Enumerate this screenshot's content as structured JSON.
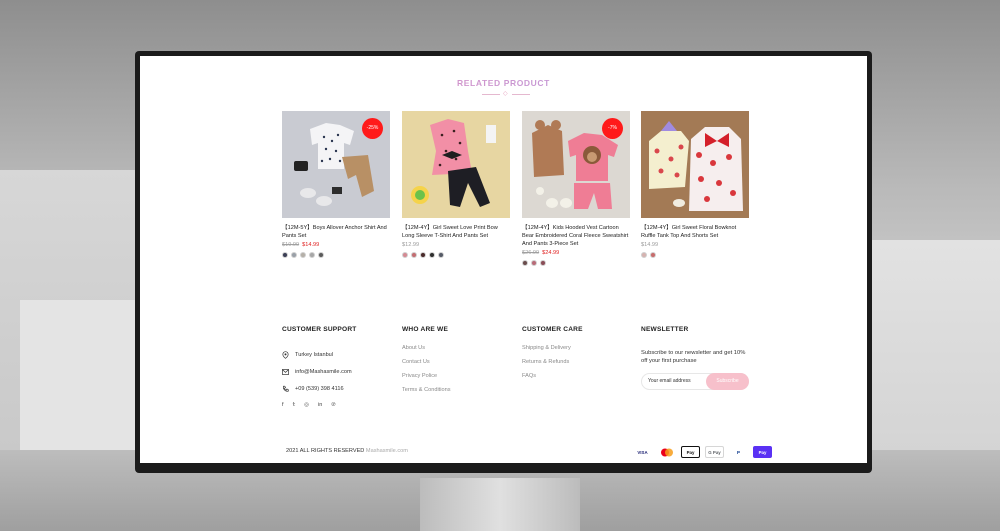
{
  "section": {
    "title": "RELATED PRODUCT"
  },
  "products": [
    {
      "name": "【12M-5Y】Boys Allover Anchor Shirt And Pants Set",
      "old_price": "$19.99",
      "price": "$14.99",
      "badge": "-25%",
      "swatches": [
        "#3b3f55",
        "#9aa0a8",
        "#b5b0a8",
        "#a7a7a7",
        "#5b5b5b"
      ]
    },
    {
      "name": "【12M-4Y】Girl Sweet Love Print Bow Long Sleeve T-Shirt And Pants Set",
      "price": "$12.99",
      "swatches": [
        "#d58a93",
        "#c46d72",
        "#4a2a2a",
        "#2d2d2d",
        "#555a66"
      ]
    },
    {
      "name": "【12M-4Y】Kids Hooded Vest Cartoon Bear Embroidered Coral Fleece Sweatshirt And Pants 3-Piece Set",
      "old_price": "$26.99",
      "price": "$24.99",
      "badge": "-7%",
      "swatches": [
        "#6a4c4c",
        "#b86b78",
        "#8b4d57"
      ]
    },
    {
      "name": "【12M-4Y】Girl Sweet Floral Bowknot Ruffle Tank Top And Shorts Set",
      "price": "$14.99",
      "swatches": [
        "#d6b3b0",
        "#c86c6c"
      ]
    }
  ],
  "footer": {
    "customer_support": {
      "heading": "CUSTOMER SUPPORT",
      "address": "Turkey Istanbul",
      "email": "info@Mashasmile.com",
      "phone": "+09 (539) 398 4116",
      "social": [
        "f",
        "t",
        "ig",
        "in",
        "p"
      ]
    },
    "who_we_are": {
      "heading": "WHO ARE WE",
      "links": [
        "About Us",
        "Contact Us",
        "Privacy Police",
        "Terms & Conditions"
      ]
    },
    "customer_care": {
      "heading": "CUSTOMER CARE",
      "links": [
        "Shipping & Delivery",
        "Returns & Refunds",
        "FAQs"
      ]
    },
    "newsletter": {
      "heading": "NEWSLETTER",
      "text": "Subscribe to our newsletter and get 10% off your first purchase",
      "placeholder": "Your email address",
      "button": "Subscribe"
    },
    "copyright": "2021 ALL RIGHTS RESERVED",
    "brand": "Mashasmile.com",
    "payments": [
      "VISA",
      "mastercard",
      "Pay",
      "G Pay",
      "P",
      "Pay"
    ]
  },
  "colors": {
    "badge": "#ff1a1a",
    "sale_price": "#e02020",
    "subscribe": "#f7c0cb"
  }
}
